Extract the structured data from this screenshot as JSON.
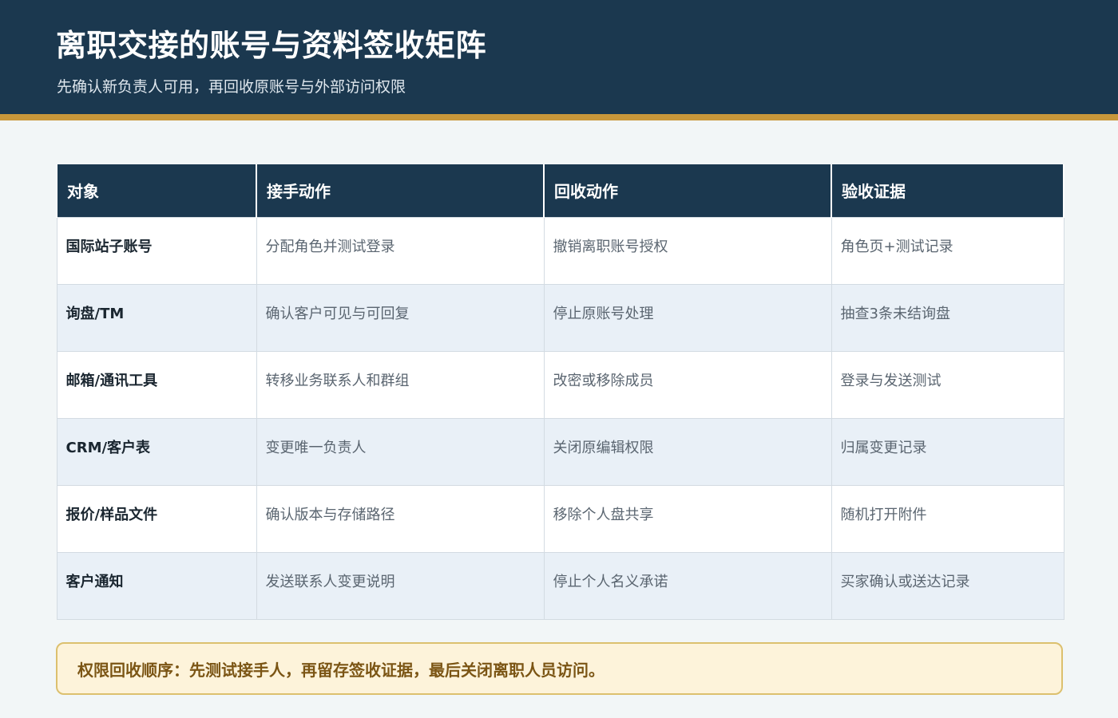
{
  "header": {
    "title": "离职交接的账号与资料签收矩阵",
    "subtitle": "先确认新负责人可用，再回收原账号与外部访问权限"
  },
  "table": {
    "columns": [
      "对象",
      "接手动作",
      "回收动作",
      "验收证据"
    ],
    "rows": [
      [
        "国际站子账号",
        "分配角色并测试登录",
        "撤销离职账号授权",
        "角色页+测试记录"
      ],
      [
        "询盘/TM",
        "确认客户可见与可回复",
        "停止原账号处理",
        "抽查3条未结询盘"
      ],
      [
        "邮箱/通讯工具",
        "转移业务联系人和群组",
        "改密或移除成员",
        "登录与发送测试"
      ],
      [
        "CRM/客户表",
        "变更唯一负责人",
        "关闭原编辑权限",
        "归属变更记录"
      ],
      [
        "报价/样品文件",
        "确认版本与存储路径",
        "移除个人盘共享",
        "随机打开附件"
      ],
      [
        "客户通知",
        "发送联系人变更说明",
        "停止个人名义承诺",
        "买家确认或送达记录"
      ]
    ]
  },
  "notice": {
    "text": "权限回收顺序：先测试接手人，再留存签收证据，最后关闭离职人员访问。"
  },
  "colors": {
    "header_bg": "#1b384f",
    "accent": "#c9973a",
    "row_alt": "#e9f0f7",
    "notice_bg": "#fdf3da",
    "notice_text": "#7b5514"
  }
}
